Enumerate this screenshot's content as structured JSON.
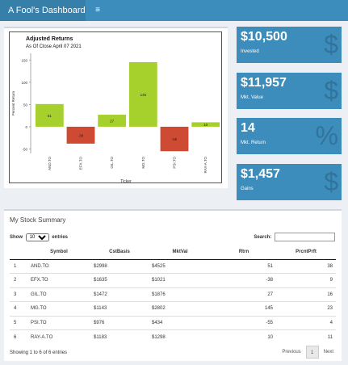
{
  "header": {
    "title": "A Fool's Dashboard",
    "menu_icon": "≡"
  },
  "chart_data": {
    "type": "bar",
    "title": "Adjusted Returns",
    "subtitle": "As Of Close April 07 2021",
    "xlabel": "Ticker",
    "ylabel": "Percent Return",
    "categories": [
      "AND.TO",
      "EFX.TO",
      "GIL.TO",
      "MG.TO",
      "PSI.TO",
      "RAY-A.TO"
    ],
    "values": [
      51,
      -38,
      27,
      145,
      -55,
      10
    ],
    "value_labels": [
      "51",
      "-38",
      "27",
      "145",
      "-55",
      "10"
    ],
    "colors": [
      "#a6d12c",
      "#cf4a33",
      "#a6d12c",
      "#a6d12c",
      "#cf4a33",
      "#a6d12c"
    ],
    "ylim": [
      -60,
      165
    ],
    "yticks": [
      -50,
      0,
      50,
      100,
      150
    ],
    "grid": false,
    "legend": "none"
  },
  "value_boxes": [
    {
      "value": "$10,500",
      "label": "Invested",
      "icon": "money-icon",
      "glyph": "$"
    },
    {
      "value": "$11,957",
      "label": "Mkt. Value",
      "icon": "hand-dollar-icon",
      "glyph": "$"
    },
    {
      "value": "14",
      "label": "Mkt. Return",
      "icon": "percent-icon",
      "glyph": "%"
    },
    {
      "value": "$1,457",
      "label": "Gains",
      "icon": "dollar-icon",
      "glyph": "$"
    }
  ],
  "summary": {
    "title": "My Stock Summary",
    "show_label": "Show",
    "entries_value": "10",
    "entries_label": "entries",
    "search_label": "Search:",
    "columns": [
      "",
      "Symbol",
      "CstBasis",
      "MktVal",
      "Rtrn",
      "PrcntPrft"
    ],
    "rows": [
      [
        "1",
        "AND.TO",
        "$2998",
        "$4525",
        "51",
        "38"
      ],
      [
        "2",
        "EFX.TO",
        "$1635",
        "$1021",
        "-38",
        "9"
      ],
      [
        "3",
        "GIL.TO",
        "$1472",
        "$1876",
        "27",
        "16"
      ],
      [
        "4",
        "MG.TO",
        "$1143",
        "$2802",
        "145",
        "23"
      ],
      [
        "5",
        "PSI.TO",
        "$976",
        "$434",
        "-55",
        "4"
      ],
      [
        "6",
        "RAY-A.TO",
        "$1183",
        "$1298",
        "10",
        "11"
      ]
    ],
    "info": "Showing 1 to 6 of 6 entries",
    "prev": "Previous",
    "page": "1",
    "next": "Next"
  }
}
